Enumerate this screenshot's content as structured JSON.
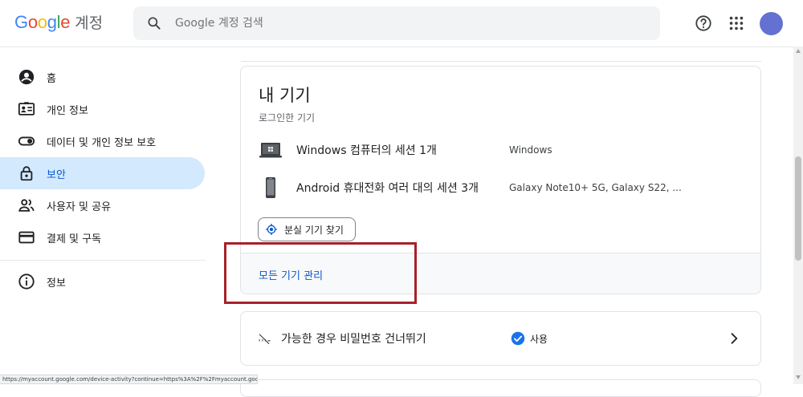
{
  "header": {
    "brand": "Google",
    "brand_letters": [
      "G",
      "o",
      "o",
      "g",
      "l",
      "e"
    ],
    "brand_colors": [
      "#4285f4",
      "#ea4335",
      "#fbbc05",
      "#4285f4",
      "#34a853",
      "#ea4335"
    ],
    "product": "계정",
    "search_placeholder": "Google 계정 검색",
    "avatar_color": "#6371d0"
  },
  "sidebar": {
    "items": [
      {
        "label": "홈",
        "icon": "account-circle-icon"
      },
      {
        "label": "개인 정보",
        "icon": "id-card-icon"
      },
      {
        "label": "데이터 및 개인 정보 보호",
        "icon": "toggle-icon"
      },
      {
        "label": "보안",
        "icon": "lock-icon",
        "active": true
      },
      {
        "label": "사용자 및 공유",
        "icon": "people-icon"
      },
      {
        "label": "결제 및 구독",
        "icon": "credit-card-icon"
      }
    ],
    "footer_item": {
      "label": "정보",
      "icon": "info-icon"
    }
  },
  "devices_card": {
    "title": "내 기기",
    "subtitle": "로그인한 기기",
    "devices": [
      {
        "name": "Windows 컴퓨터의 세션 1개",
        "detail": "Windows",
        "icon": "laptop-icon"
      },
      {
        "name": "Android 휴대전화 여러 대의 세션 3개",
        "detail": "Galaxy Note10+ 5G, Galaxy S22, ...",
        "icon": "phone-icon"
      }
    ],
    "find_device_button": "분실 기기 찾기",
    "manage_link": "모든 기기 관리"
  },
  "passkey_card": {
    "label": "가능한 경우 비밀번호 건너뛰기",
    "status": "사용"
  },
  "status_bar_url": "https://myaccount.google.com/device-activity?continue=https%3A%2F%2Fmyaccount.google.com%2Fsecurity",
  "colors": {
    "accent": "#0b57d0",
    "active_bg": "#d3e9fd",
    "highlight_box": "#a8202a",
    "check": "#1a73e8"
  }
}
